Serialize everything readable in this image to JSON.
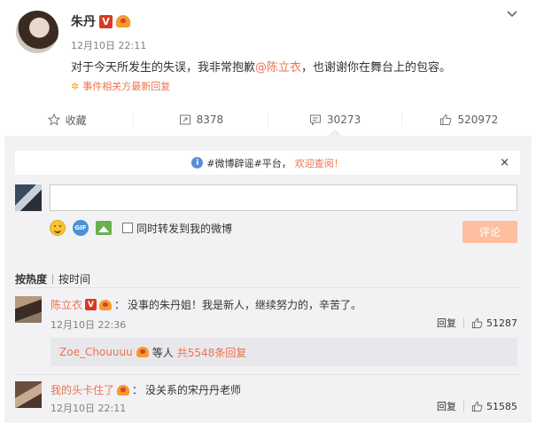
{
  "post": {
    "author": "朱丹",
    "verified_badge": "V",
    "time": "12月10日 22:11",
    "text_before": "对于今天所发生的失误，我非常抱歉",
    "mention": "@陈立衣",
    "text_after": "，也谢谢你在舞台上的包容。",
    "related_label": "事件相关方最新回复"
  },
  "actions": {
    "favorite_label": "收藏",
    "repost_count": "8378",
    "comment_count": "30273",
    "like_count": "520972"
  },
  "notice": {
    "prefix": "#微博辟谣#平台，",
    "link": "欢迎查阅！",
    "close": "×"
  },
  "composer": {
    "gif_label": "GIF",
    "repost_checkbox_label": "同时转发到我的微博",
    "submit_label": "评论"
  },
  "sort": {
    "hot": "按热度",
    "time": "按时间"
  },
  "comments": [
    {
      "user": "陈立衣",
      "verified_badge": "V",
      "separator": "：",
      "text": "没事的朱丹姐！我是新人，继续努力的，辛苦了。",
      "time": "12月10日 22:36",
      "reply_label": "回复",
      "likes": "51287",
      "sub_reply": {
        "user": "Zoe_Chouuuu",
        "text": "等人",
        "link": "共5548条回复"
      }
    },
    {
      "user": "我的头卡住了",
      "separator": "：",
      "text": "没关系的宋丹丹老师",
      "time": "12月10日 22:11",
      "reply_label": "回复",
      "likes": "51585"
    }
  ],
  "colors": {
    "accent": "#eb7350",
    "panel_bg": "#f2f2f5",
    "submit_disabled": "#fdbf9f"
  }
}
